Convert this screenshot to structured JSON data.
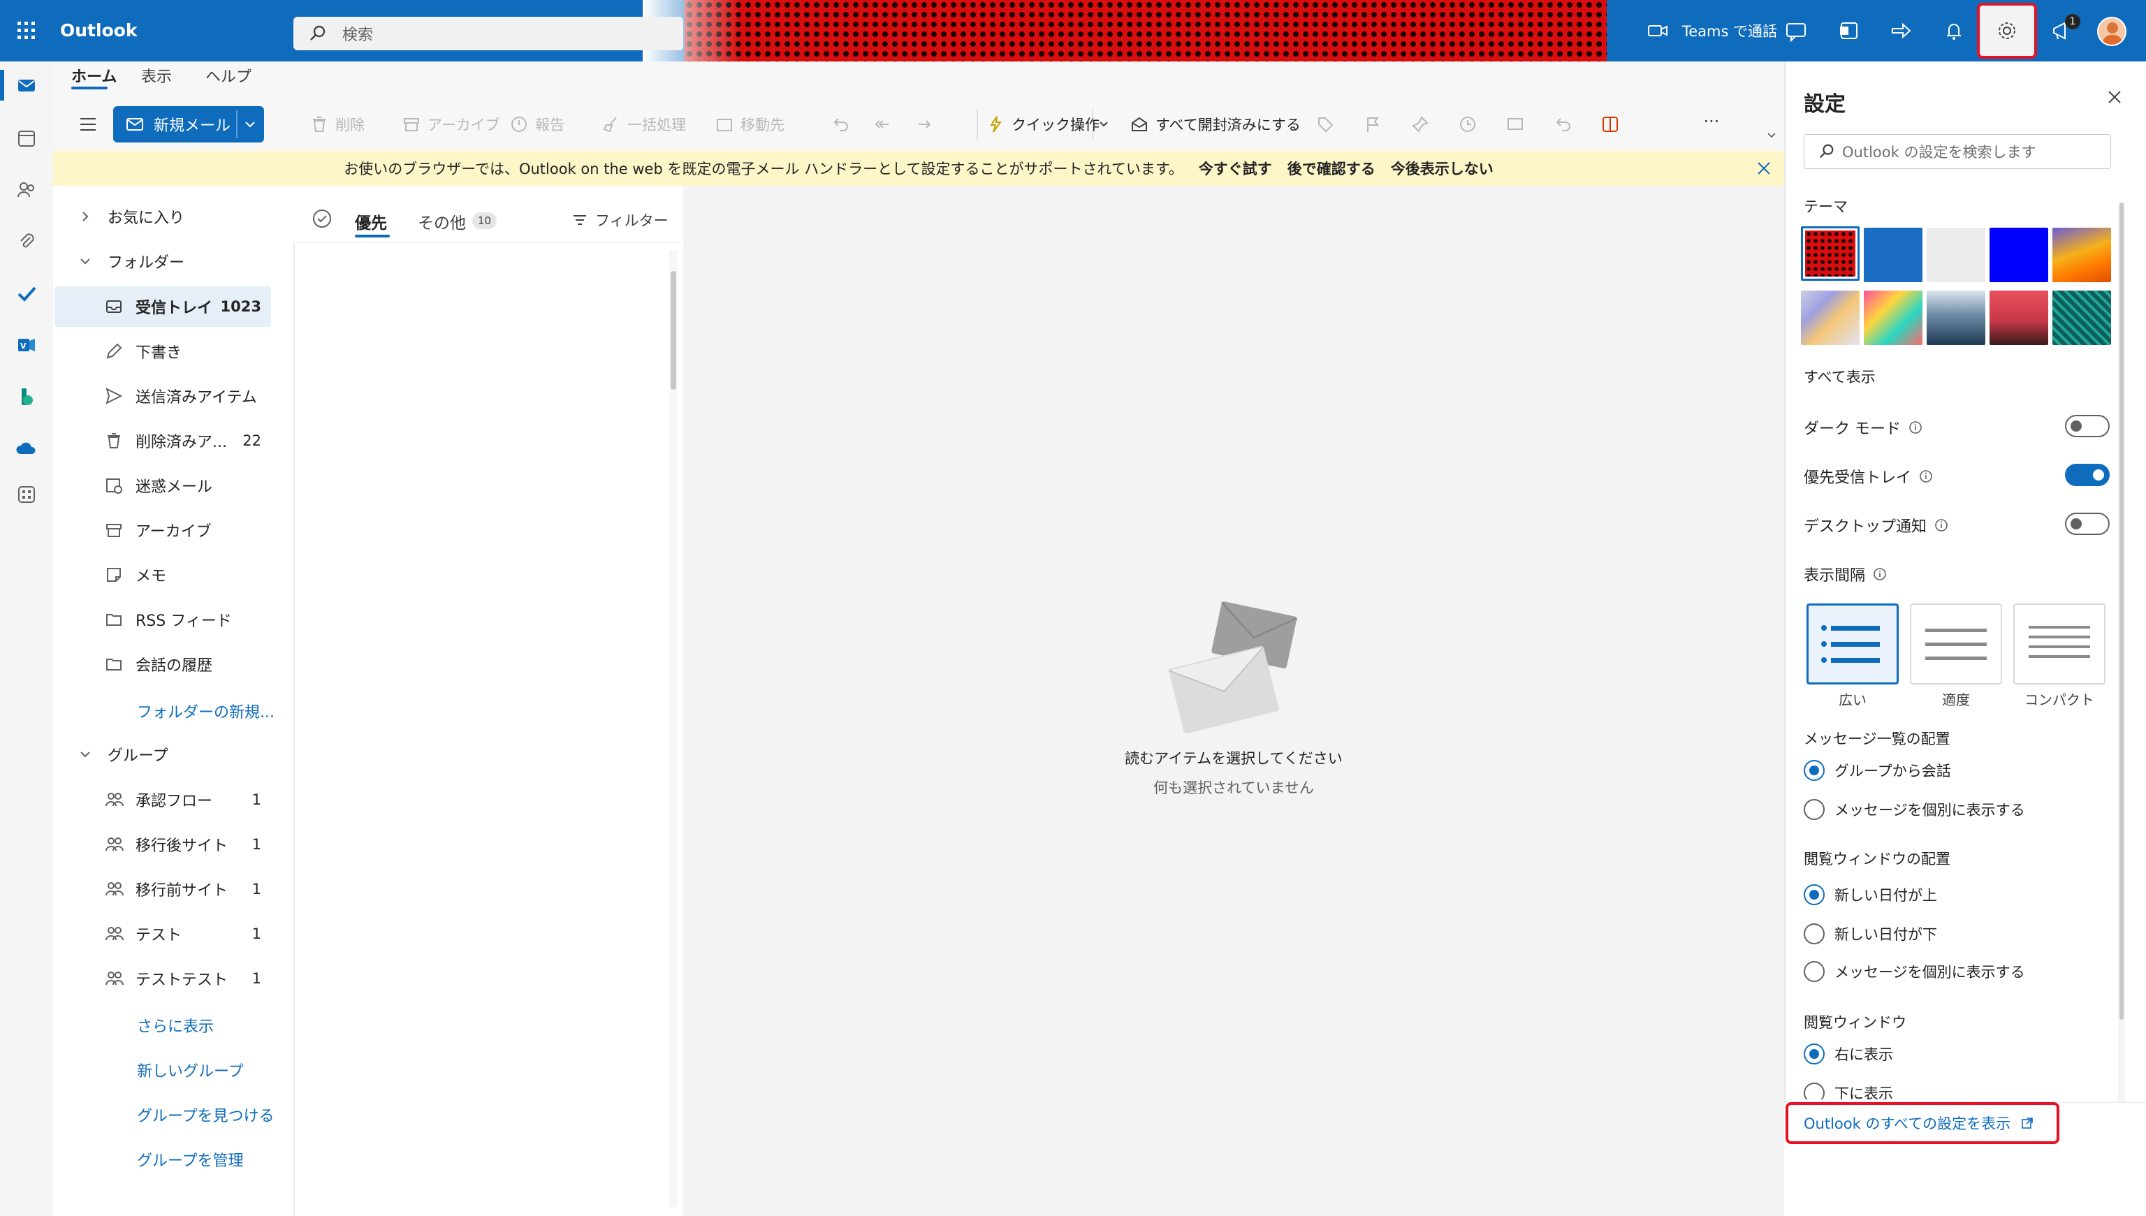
{
  "app": {
    "title": "Outlook"
  },
  "search": {
    "placeholder": "検索"
  },
  "topbar": {
    "teams_label": "Teams で通話",
    "whatsnew_badge": "1"
  },
  "ribbon": {
    "tabs": [
      "ホーム",
      "表示",
      "ヘルプ"
    ],
    "new_mail": "新規メール",
    "delete": "削除",
    "archive": "アーカイブ",
    "report": "報告",
    "sweep": "一括処理",
    "move": "移動先",
    "quick_steps": "クイック操作",
    "mark_all_read": "すべて開封済みにする",
    "more": "···"
  },
  "infobar": {
    "message": "お使いのブラウザーでは、Outlook on the web を既定の電子メール ハンドラーとして設定することがサポートされています。",
    "try_now": "今すぐ試す",
    "later": "後で確認する",
    "dont_show": "今後表示しない"
  },
  "folders": {
    "favorites": "お気に入り",
    "folders_header": "フォルダー",
    "items": [
      {
        "label": "受信トレイ",
        "count": "1023"
      },
      {
        "label": "下書き",
        "count": ""
      },
      {
        "label": "送信済みアイテム",
        "count": ""
      },
      {
        "label": "削除済みア...",
        "count": "22"
      },
      {
        "label": "迷惑メール",
        "count": ""
      },
      {
        "label": "アーカイブ",
        "count": ""
      },
      {
        "label": "メモ",
        "count": ""
      },
      {
        "label": "RSS フィード",
        "count": ""
      },
      {
        "label": "会話の履歴",
        "count": ""
      }
    ],
    "new_folder": "フォルダーの新規...",
    "groups_header": "グループ",
    "groups": [
      {
        "label": "承認フロー",
        "count": "1"
      },
      {
        "label": "移行後サイト",
        "count": "1"
      },
      {
        "label": "移行前サイト",
        "count": "1"
      },
      {
        "label": "テスト",
        "count": "1"
      },
      {
        "label": "テストテスト",
        "count": "1"
      }
    ],
    "show_more": "さらに表示",
    "new_group": "新しいグループ",
    "find_group": "グループを見つける",
    "manage_groups": "グループを管理"
  },
  "message_list": {
    "focused": "優先",
    "other": "その他",
    "other_count": "10",
    "filter": "フィルター"
  },
  "reading_pane": {
    "title": "読むアイテムを選択してください",
    "subtitle": "何も選択されていません"
  },
  "settings": {
    "title": "設定",
    "search_placeholder": "Outlook の設定を検索します",
    "theme_label": "テーマ",
    "show_all": "すべて表示",
    "dark_mode": "ダーク モード",
    "dark_mode_on": false,
    "focused_inbox": "優先受信トレイ",
    "focused_inbox_on": true,
    "desktop_notifications": "デスクトップ通知",
    "desktop_notifications_on": false,
    "display_density": "表示間隔",
    "density_options": [
      "広い",
      "適度",
      "コンパクト"
    ],
    "density_selected": "広い",
    "conversation_label": "メッセージ一覧の配置",
    "conversation_options": [
      "グループから会話",
      "メッセージを個別に表示する"
    ],
    "conversation_selected": "グループから会話",
    "reading_order_label": "閲覧ウィンドウの配置",
    "reading_order_options": [
      "新しい日付が上",
      "新しい日付が下",
      "メッセージを個別に表示する"
    ],
    "reading_order_selected": "新しい日付が上",
    "reading_pane_label": "閲覧ウィンドウ",
    "reading_pane_options": [
      "右に表示",
      "下に表示"
    ],
    "reading_pane_selected": "右に表示",
    "view_all": "Outlook のすべての設定を表示"
  },
  "colors": {
    "accent": "#0f6cbd",
    "highlight_box": "#e81123",
    "infobar_bg": "#fdf6c9"
  }
}
